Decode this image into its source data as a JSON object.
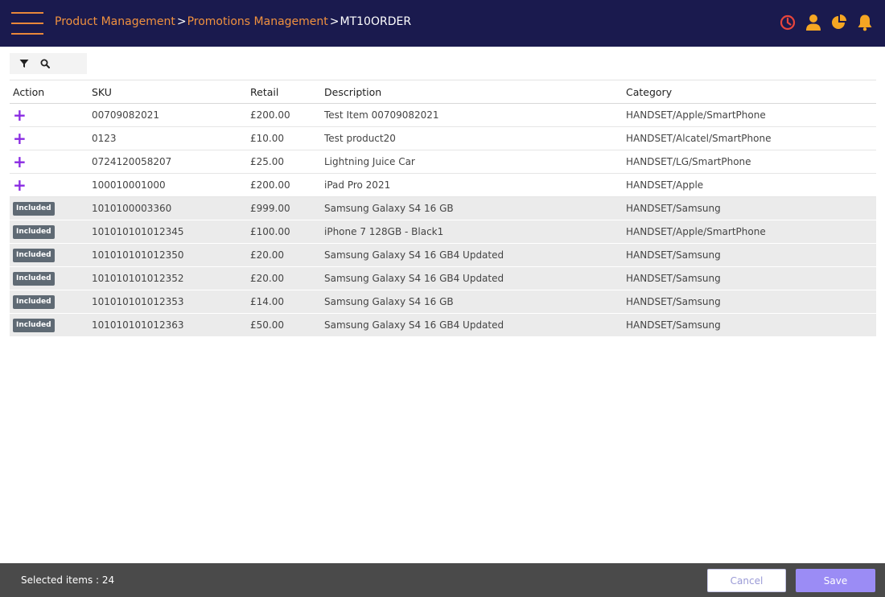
{
  "header": {
    "breadcrumb": {
      "item1": "Product Management",
      "item2": "Promotions Management",
      "current": "MT10ORDER",
      "separator": ">"
    },
    "icons": [
      "clock-icon",
      "user-icon",
      "pie-chart-icon",
      "bell-icon"
    ],
    "colors": {
      "background": "#1a1a4e",
      "accent": "#f0913f",
      "clock": "#e8453c",
      "icons": "#f5a623"
    }
  },
  "toolbar": {
    "icons": [
      "filter-icon",
      "search-icon"
    ]
  },
  "table": {
    "columns": [
      "Action",
      "SKU",
      "Retail",
      "Description",
      "Category"
    ],
    "rows": [
      {
        "action": "+",
        "sku": "00709082021",
        "retail": "£200.00",
        "description": "Test Item 00709082021",
        "category": "HANDSET/Apple/SmartPhone"
      },
      {
        "action": "+",
        "sku": "0123",
        "retail": "£10.00",
        "description": "Test product20",
        "category": "HANDSET/Alcatel/SmartPhone"
      },
      {
        "action": "+",
        "sku": "0724120058207",
        "retail": "£25.00",
        "description": "Lightning Juice Car",
        "category": "HANDSET/LG/SmartPhone"
      },
      {
        "action": "+",
        "sku": "100010001000",
        "retail": "£200.00",
        "description": "iPad Pro 2021",
        "category": "HANDSET/Apple"
      },
      {
        "action": "Included",
        "sku": "1010100003360",
        "retail": "£999.00",
        "description": "Samsung Galaxy S4 16 GB",
        "category": "HANDSET/Samsung"
      },
      {
        "action": "Included",
        "sku": "101010101012345",
        "retail": "£100.00",
        "description": "iPhone 7 128GB - Black1",
        "category": "HANDSET/Apple/SmartPhone"
      },
      {
        "action": "Included",
        "sku": "101010101012350",
        "retail": "£20.00",
        "description": "Samsung Galaxy S4 16 GB4 Updated",
        "category": "HANDSET/Samsung"
      },
      {
        "action": "Included",
        "sku": "101010101012352",
        "retail": "£20.00",
        "description": "Samsung Galaxy S4 16 GB4 Updated",
        "category": "HANDSET/Samsung"
      },
      {
        "action": "Included",
        "sku": "101010101012353",
        "retail": "£14.00",
        "description": "Samsung Galaxy S4 16 GB",
        "category": "HANDSET/Samsung"
      },
      {
        "action": "Included",
        "sku": "101010101012363",
        "retail": "£50.00",
        "description": "Samsung Galaxy S4 16 GB4 Updated",
        "category": "HANDSET/Samsung"
      }
    ],
    "colors": {
      "add": "#8a2be2",
      "badge": "#5f6a74",
      "included_row": "#ebebeb"
    }
  },
  "footer": {
    "selected_text": "Selected items : 24",
    "cancel_label": "Cancel",
    "save_label": "Save",
    "colors": {
      "background": "#4a4a4a",
      "save": "#9b8cf5"
    }
  }
}
